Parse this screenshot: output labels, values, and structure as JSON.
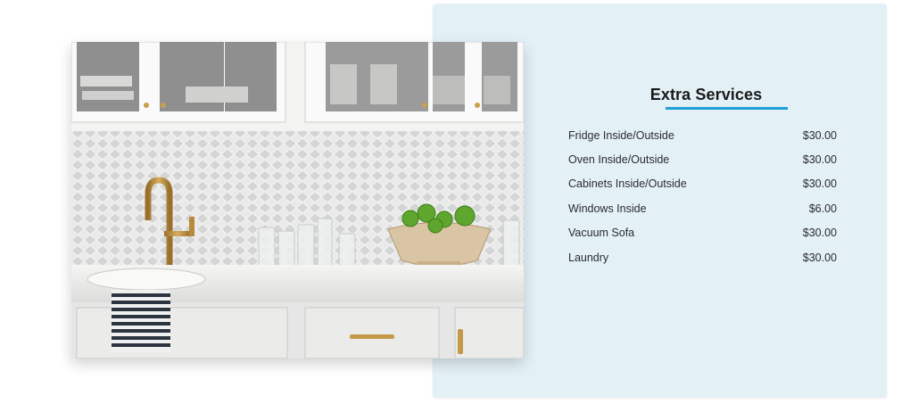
{
  "services": {
    "title": "Extra Services",
    "items": [
      {
        "name": "Fridge Inside/Outside",
        "price": "$30.00"
      },
      {
        "name": "Oven Inside/Outside",
        "price": "$30.00"
      },
      {
        "name": "Cabinets Inside/Outside",
        "price": "$30.00"
      },
      {
        "name": "Windows Inside",
        "price": "$6.00"
      },
      {
        "name": "Vacuum Sofa",
        "price": "$30.00"
      },
      {
        "name": "Laundry",
        "price": "$30.00"
      }
    ]
  },
  "colors": {
    "panel_bg": "#e3f1f7",
    "accent_underline": "#1ea0d6",
    "text": "#2b2b2b"
  }
}
